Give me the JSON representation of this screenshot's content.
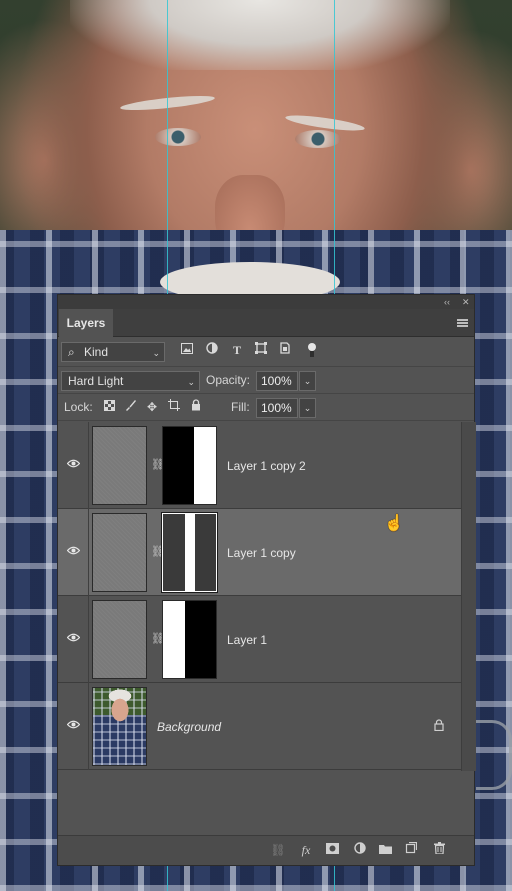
{
  "panel": {
    "tab_title": "Layers",
    "collapse_glyph": "‹‹",
    "close_glyph": "✕",
    "menu_icon": "panel-menu-icon"
  },
  "filter": {
    "kind_icon": "search-icon",
    "kind_value": "Kind",
    "filter_icons": [
      "image-filter-icon",
      "adjustment-filter-icon",
      "type-filter-icon",
      "shape-filter-icon",
      "smart-object-filter-icon",
      "filter-toggle-icon"
    ]
  },
  "blend": {
    "mode_value": "Hard Light",
    "opacity_label": "Opacity:",
    "opacity_value": "100%"
  },
  "lock": {
    "label": "Lock:",
    "icons": [
      "lock-transparent-pixels-icon",
      "lock-image-pixels-icon",
      "lock-position-icon",
      "lock-artboard-icon",
      "lock-all-icon"
    ],
    "fill_label": "Fill:",
    "fill_value": "100%"
  },
  "layers": [
    {
      "name": "Layer 1 copy 2",
      "visible": true,
      "selected": false,
      "mask": "black-left-white-right"
    },
    {
      "name": "Layer 1 copy",
      "visible": true,
      "selected": true,
      "mask": "white-center-stripe"
    },
    {
      "name": "Layer 1",
      "visible": true,
      "selected": false,
      "mask": "white-left-black-right"
    },
    {
      "name": "Background",
      "visible": true,
      "selected": false,
      "locked": true,
      "italic": true
    }
  ],
  "bottom_icons": [
    "link-layers-icon",
    "fx-icon",
    "add-mask-icon",
    "adjustment-layer-icon",
    "new-group-icon",
    "new-layer-icon",
    "delete-icon"
  ],
  "colors": {
    "panel_bg": "#535353",
    "selected_layer_bg": "#6a6a6a",
    "guide": "#33c7d4"
  }
}
